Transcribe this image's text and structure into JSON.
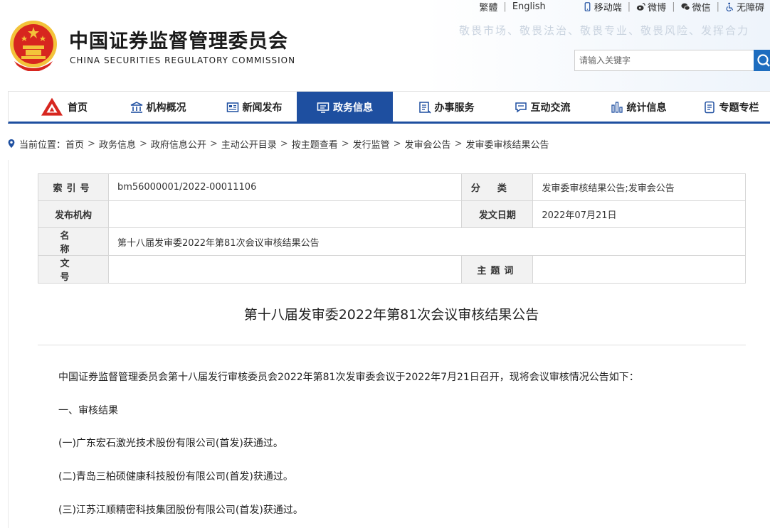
{
  "header": {
    "title_cn": "中国证券监督管理委员会",
    "title_en": "CHINA SECURITIES REGULATORY COMMISSION",
    "slogan": "敬畏市场、敬畏法治、敬畏专业、敬畏风险、发挥合力",
    "links": {
      "traditional": "繁體",
      "english": "English",
      "mobile": "移动端",
      "weibo": "微博",
      "wechat": "微信",
      "accessible": "无障碍"
    },
    "search_placeholder": "请输入关键字"
  },
  "nav": [
    {
      "label": "首页",
      "icon": "csrc-logo-icon"
    },
    {
      "label": "机构概况",
      "icon": "building-icon"
    },
    {
      "label": "新闻发布",
      "icon": "newspaper-icon"
    },
    {
      "label": "政务信息",
      "icon": "monitor-icon",
      "active": true
    },
    {
      "label": "办事服务",
      "icon": "list-icon"
    },
    {
      "label": "互动交流",
      "icon": "chat-icon"
    },
    {
      "label": "统计信息",
      "icon": "bar-chart-icon"
    },
    {
      "label": "专题专栏",
      "icon": "document-icon"
    }
  ],
  "breadcrumb": {
    "prefix": "当前位置：",
    "items": [
      "首页",
      "政务信息",
      "政府信息公开",
      "主动公开目录",
      "按主题查看",
      "发行监管",
      "发审会公告",
      "发审委审核结果公告"
    ]
  },
  "info": {
    "index_label": "索引号",
    "index_value": "bm56000001/2022-00011106",
    "category_label": "分类",
    "category_value": "发审委审核结果公告;发审会公告",
    "publisher_label": "发布机构",
    "publisher_value": "",
    "date_label": "发文日期",
    "date_value": "2022年07月21日",
    "name_label": "名称",
    "name_value": "第十八届发审委2022年第81次会议审核结果公告",
    "docno_label": "文号",
    "docno_value": "",
    "subject_label": "主题词",
    "subject_value": ""
  },
  "doc": {
    "title": "第十八届发审委2022年第81次会议审核结果公告",
    "intro": "中国证券监督管理委员会第十八届发行审核委员会2022年第81次发审委会议于2022年7月21日召开，现将会议审核情况公告如下：",
    "section1": "一、审核结果",
    "items": [
      "(一)广东宏石激光技术股份有限公司(首发)获通过。",
      "(二)青岛三柏硕健康科技股份有限公司(首发)获通过。",
      "(三)江苏江顺精密科技集团股份有限公司(首发)获通过。"
    ]
  },
  "colors": {
    "brand_blue": "#1e4fa0",
    "search_blue": "#1e6dbf",
    "emblem_red": "#d7261f",
    "emblem_gold": "#f3c33a"
  }
}
